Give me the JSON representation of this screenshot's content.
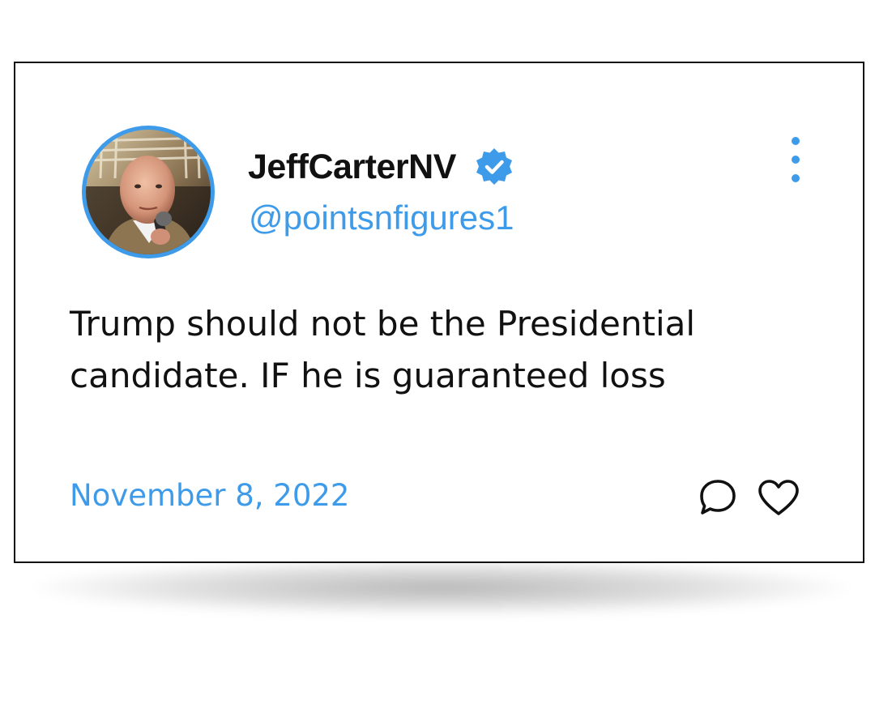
{
  "tweet": {
    "display_name": "JeffCarterNV",
    "handle": "@pointsnfigures1",
    "verified": true,
    "text": "Trump should not be the Presidential candidate. IF he is guaranteed loss",
    "date": "November 8, 2022"
  },
  "icons": {
    "avatar": "profile-photo",
    "verified": "verified-badge-icon",
    "more": "more-options-icon",
    "reply": "reply-bubble-icon",
    "like": "heart-icon"
  },
  "colors": {
    "accent": "#3d9be9",
    "text": "#111111",
    "border": "#111111",
    "background": "#ffffff"
  }
}
